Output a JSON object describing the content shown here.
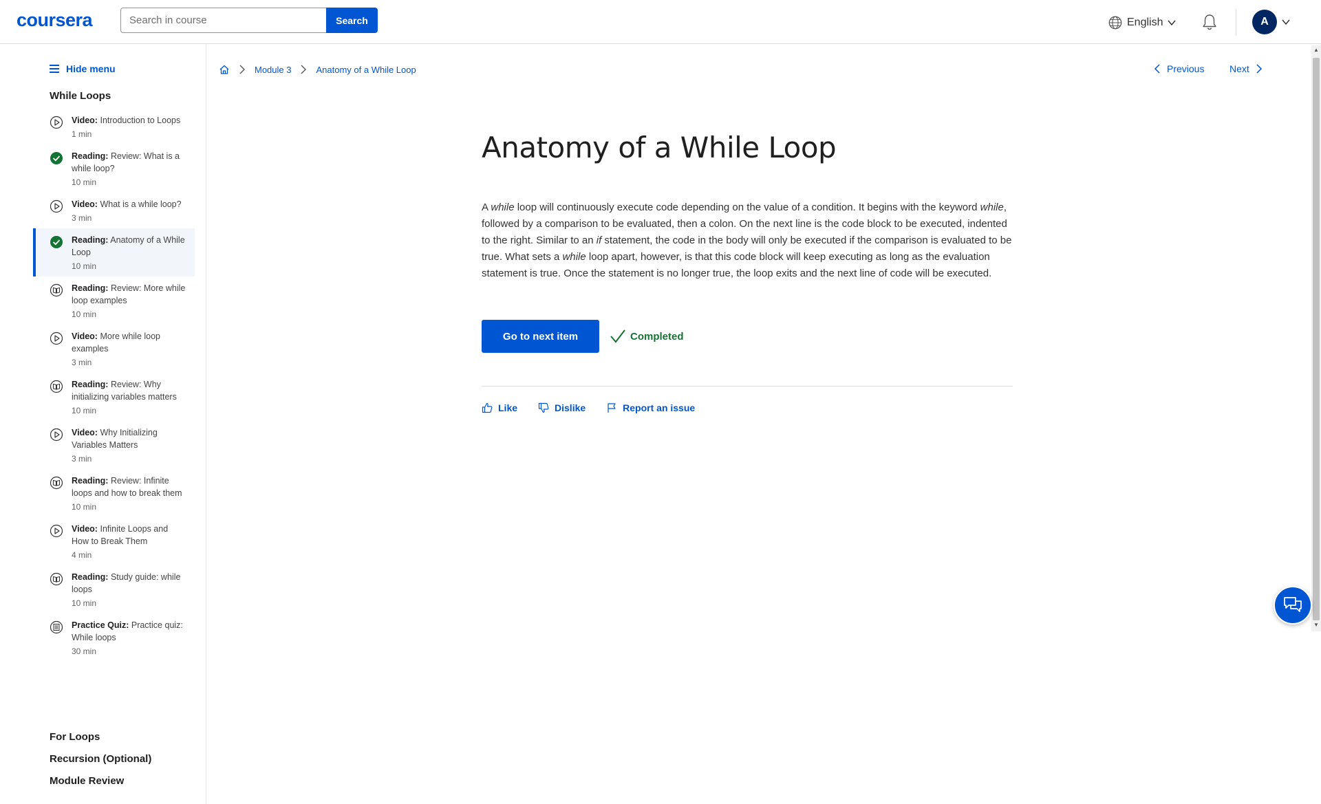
{
  "header": {
    "logo": "coursera",
    "search_placeholder": "Search in course",
    "search_button": "Search",
    "language": "English",
    "avatar_initial": "A"
  },
  "sidebar": {
    "hide_menu": "Hide menu",
    "module_title": "While Loops",
    "items": [
      {
        "type": "Video:",
        "title": "Introduction to Loops",
        "duration": "1 min",
        "icon": "play-icon",
        "status": "not-started"
      },
      {
        "type": "Reading:",
        "title": "Review: What is a while loop?",
        "duration": "10 min",
        "icon": "check-circle-icon",
        "status": "completed"
      },
      {
        "type": "Video:",
        "title": "What is a while loop?",
        "duration": "3 min",
        "icon": "play-icon",
        "status": "not-started"
      },
      {
        "type": "Reading:",
        "title": "Anatomy of a While Loop",
        "duration": "10 min",
        "icon": "check-circle-icon",
        "status": "completed",
        "active": true
      },
      {
        "type": "Reading:",
        "title": "Review: More while loop examples",
        "duration": "10 min",
        "icon": "book-icon",
        "status": "not-started"
      },
      {
        "type": "Video:",
        "title": "More while loop examples",
        "duration": "3 min",
        "icon": "play-icon",
        "status": "not-started"
      },
      {
        "type": "Reading:",
        "title": "Review: Why initializing variables matters",
        "duration": "10 min",
        "icon": "book-icon",
        "status": "not-started"
      },
      {
        "type": "Video:",
        "title": "Why Initializing Variables Matters",
        "duration": "3 min",
        "icon": "play-icon",
        "status": "not-started"
      },
      {
        "type": "Reading:",
        "title": "Review: Infinite loops and how to break them",
        "duration": "10 min",
        "icon": "book-icon",
        "status": "not-started"
      },
      {
        "type": "Video:",
        "title": "Infinite Loops and How to Break Them",
        "duration": "4 min",
        "icon": "play-icon",
        "status": "not-started"
      },
      {
        "type": "Reading:",
        "title": "Study guide: while loops",
        "duration": "10 min",
        "icon": "book-icon",
        "status": "not-started"
      },
      {
        "type": "Practice Quiz:",
        "title": "Practice quiz: While loops",
        "duration": "30 min",
        "icon": "quiz-icon",
        "status": "not-started"
      }
    ],
    "sections": [
      "For Loops",
      "Recursion (Optional)",
      "Module Review"
    ]
  },
  "breadcrumb": {
    "module": "Module 3",
    "current": "Anatomy of a While Loop"
  },
  "nav": {
    "previous": "Previous",
    "next": "Next"
  },
  "content": {
    "title": "Anatomy of a While Loop",
    "p1": "A ",
    "e1": "while",
    "p2": " loop will continuously execute code depending on the value of a condition. It begins with the keyword ",
    "e2": "while",
    "p3": ", followed by a comparison to be evaluated, then a colon. On the next line is the code block to be executed, indented to the right. Similar to an ",
    "e3": "if",
    "p4": " statement, the code in the body will only be executed if the comparison is evaluated to be true. What sets a ",
    "e4": "while",
    "p5": " loop apart, however, is that this code block will keep executing as long as the evaluation statement is true. Once the statement is no longer true, the loop exits and the next line of code will be executed.",
    "next_button": "Go to next item",
    "completed": "Completed",
    "like": "Like",
    "dislike": "Dislike",
    "report": "Report an issue"
  },
  "colors": {
    "brand": "#0056d2",
    "completed": "#137333",
    "active_bg": "#f2f5fa"
  }
}
